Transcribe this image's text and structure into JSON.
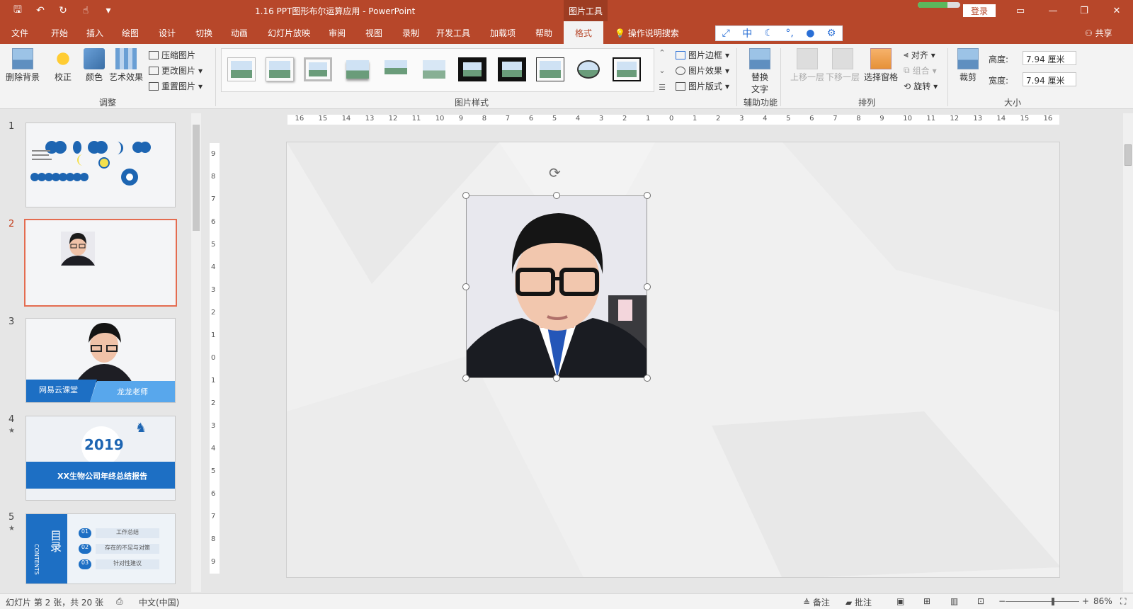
{
  "window": {
    "title": "1.16 PPT图形布尔运算应用  -  PowerPoint",
    "context_tab": "图片工具",
    "login": "登录",
    "sync_progress_percent": 70
  },
  "menu": {
    "tabs": [
      "文件",
      "开始",
      "插入",
      "绘图",
      "设计",
      "切换",
      "动画",
      "幻灯片放映",
      "审阅",
      "视图",
      "录制",
      "开发工具",
      "加载项",
      "帮助",
      "格式"
    ],
    "active_tab": "格式",
    "tell_me": "操作说明搜索",
    "share": "共享"
  },
  "ribbon": {
    "remove_bg": "删除背景",
    "correct": "校正",
    "color": "颜色",
    "artistic": "艺术效果",
    "compress": "压缩图片",
    "change": "更改图片",
    "reset": "重置图片",
    "group_adjust": "调整",
    "group_styles": "图片样式",
    "border": "图片边框",
    "effects": "图片效果",
    "layout": "图片版式",
    "alt_text_line1": "替换",
    "alt_text_line2": "文字",
    "group_access": "辅助功能",
    "bring_forward": "上移一层",
    "send_backward": "下移一层",
    "selection_pane": "选择窗格",
    "align": "对齐",
    "group_btn": "组合",
    "rotate": "旋转",
    "group_arrange": "排列",
    "crop": "裁剪",
    "height_label": "高度:",
    "height_value": "7.94 厘米",
    "width_label": "宽度:",
    "width_value": "7.94 厘米",
    "group_size": "大小"
  },
  "thumbnails": {
    "numbers": [
      "1",
      "2",
      "3",
      "4",
      "5"
    ],
    "selected": "2",
    "slide3_left": "网易云课堂",
    "slide3_right": "龙龙老师",
    "slide4_year": "2019",
    "slide4_title": "XX生物公司年终总结报告",
    "slide5_title": "目录",
    "slide5_sub": "CONTENTS",
    "slide5_items": [
      "工作总结",
      "存在的不足与对策",
      "针对性建议"
    ],
    "slide5_nums": [
      "01",
      "02",
      "03"
    ]
  },
  "ruler": {
    "h_labels": [
      "16",
      "15",
      "14",
      "13",
      "12",
      "11",
      "10",
      "9",
      "8",
      "7",
      "6",
      "5",
      "4",
      "3",
      "2",
      "1",
      "0",
      "1",
      "2",
      "3",
      "4",
      "5",
      "6",
      "7",
      "8",
      "9",
      "10",
      "11",
      "12",
      "13",
      "14",
      "15",
      "16"
    ],
    "v_labels": [
      "9",
      "8",
      "7",
      "6",
      "5",
      "4",
      "3",
      "2",
      "1",
      "0",
      "1",
      "2",
      "3",
      "4",
      "5",
      "6",
      "7",
      "8",
      "9"
    ]
  },
  "status": {
    "slide_info": "幻灯片 第 2 张，共 20 张",
    "language": "中文(中国)",
    "notes": "备注",
    "comments": "批注",
    "zoom": "86%",
    "zoom_level_percent": 86
  },
  "icons": [
    "save-icon",
    "undo-icon",
    "redo-icon",
    "touch-mode-icon",
    "customize-icon",
    "lightbulb-icon",
    "share-person-icon",
    "rotate-handle-icon"
  ],
  "colors": {
    "accent": "#b7472a",
    "selection": "#e46c50",
    "link_blue": "#2a6fd6"
  }
}
